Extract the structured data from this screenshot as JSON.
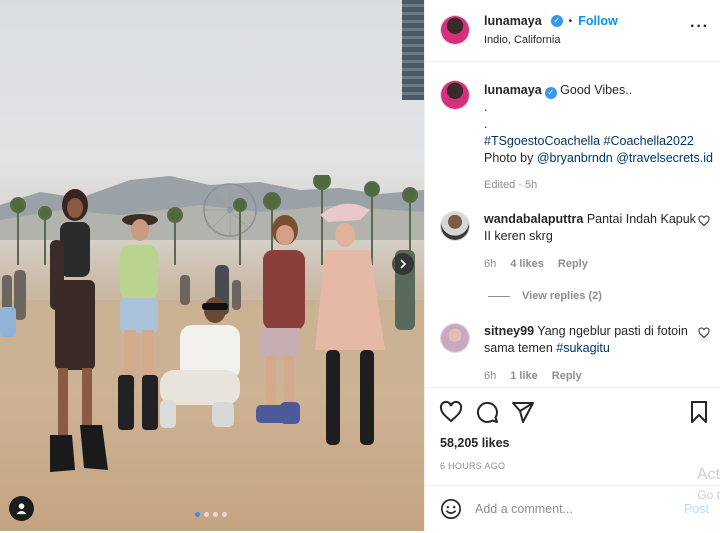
{
  "post": {
    "username": "lunamaya",
    "follow_label": "Follow",
    "location": "Indio, California",
    "more_icon": "more-options-icon"
  },
  "caption": {
    "username": "lunamaya",
    "text": "Good Vibes..",
    "dot1": ".",
    "dot2": ".",
    "hashtags": "#TSgoestoCoachella #Coachella2022",
    "credit_prefix": "Photo by",
    "mentions": "@bryanbrndn @travelsecrets.id",
    "edited": "Edited",
    "time": "5h"
  },
  "comments": [
    {
      "username": "wandabalaputtra",
      "text": "Pantai Indah Kapuk II keren skrg",
      "time": "6h",
      "likes": "4 likes",
      "reply": "Reply"
    },
    {
      "username": "sitney99",
      "text": "Yang ngeblur pasti di fotoin sama temen",
      "hashtag": "#sukagitu",
      "time": "6h",
      "likes": "1 like",
      "reply": "Reply"
    }
  ],
  "view_replies": "View replies (2)",
  "likes_count": "58,205 likes",
  "posted_ago": "6 HOURS AGO",
  "add_comment": {
    "placeholder": "Add a comment...",
    "post_label": "Post"
  },
  "watermark": {
    "line1": "Act",
    "line2": "Go t"
  },
  "carousel": {
    "current": 1,
    "total": 4
  },
  "colors": {
    "link": "#00376b",
    "accent": "#0095f6",
    "verified": "#3897f0",
    "muted": "#8e8e8e"
  }
}
